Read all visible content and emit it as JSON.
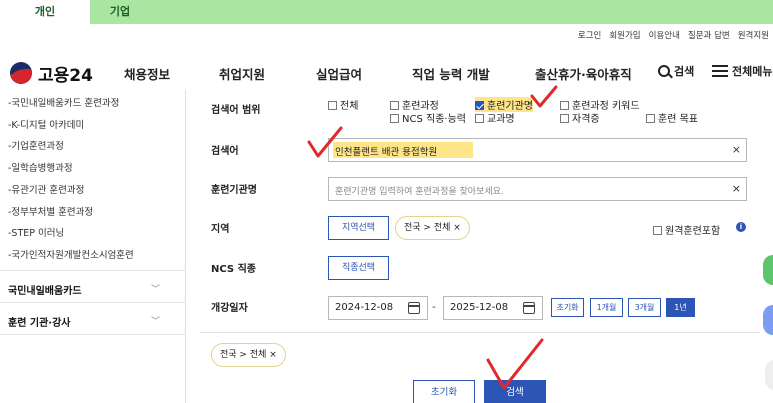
{
  "top_tabs": {
    "personal": "개인",
    "corporate": "기업"
  },
  "util_links": [
    "로그인",
    "회원가입",
    "이용안내",
    "질문과 답변",
    "원격지원"
  ],
  "logo_text": "고용24",
  "nav": [
    "채용정보",
    "취업지원",
    "실업급여",
    "직업 능력 개발",
    "출산휴가·육아휴직"
  ],
  "header_search": "검색",
  "header_menu": "전체메뉴",
  "sidebar": {
    "items": [
      "-국민내일배움카드 훈련과정",
      "-K-디지털 아카데미",
      "-기업훈련과정",
      "-일학습병행과정",
      "-유관기관 훈련과정",
      "-정부부처별 훈련과정",
      "-STEP 이러닝",
      "-국가인적자원개발컨소시엄훈련"
    ],
    "sections": [
      "국민내일배움카드",
      "훈련 기관·강사"
    ]
  },
  "form": {
    "scope_label": "검색어 범위",
    "scope_options": [
      {
        "label": "전체",
        "checked": false
      },
      {
        "label": "훈련과정",
        "checked": false
      },
      {
        "label": "훈련기관명",
        "checked": true
      },
      {
        "label": "훈련과정 키워드",
        "checked": false
      },
      {
        "label": "NCS 직종·능력",
        "checked": false
      },
      {
        "label": "교과명",
        "checked": false
      },
      {
        "label": "자격증",
        "checked": false
      },
      {
        "label": "훈련 목표",
        "checked": false
      }
    ],
    "keyword_label": "검색어",
    "keyword_value": "인천플랜트 배관 용접학원",
    "institution_label": "훈련기관명",
    "institution_placeholder": "훈련기관명 입력하여 훈련과정을 찾아보세요.",
    "region_label": "지역",
    "region_button": "지역선택",
    "region_chip": "전국 > 전체 ×",
    "remote_label": "원격훈련포함",
    "ncs_label": "NCS 직종",
    "ncs_button": "직종선택",
    "date_label": "개강일자",
    "start_date": "2024-12-08",
    "end_date": "2025-12-08",
    "date_dash": "-",
    "periods": [
      "초기화",
      "1개월",
      "3개월",
      "1년"
    ],
    "active_period": "1년",
    "selected_chip": "전국 > 전체 ×",
    "reset_button": "초기화",
    "search_button": "검색",
    "clear_symbol": "×",
    "info_symbol": "i"
  },
  "colors": {
    "accent": "#2c55b6",
    "highlight": "#ffe58a",
    "topbar": "#a8e6a1",
    "annotation": "#e0282d"
  }
}
